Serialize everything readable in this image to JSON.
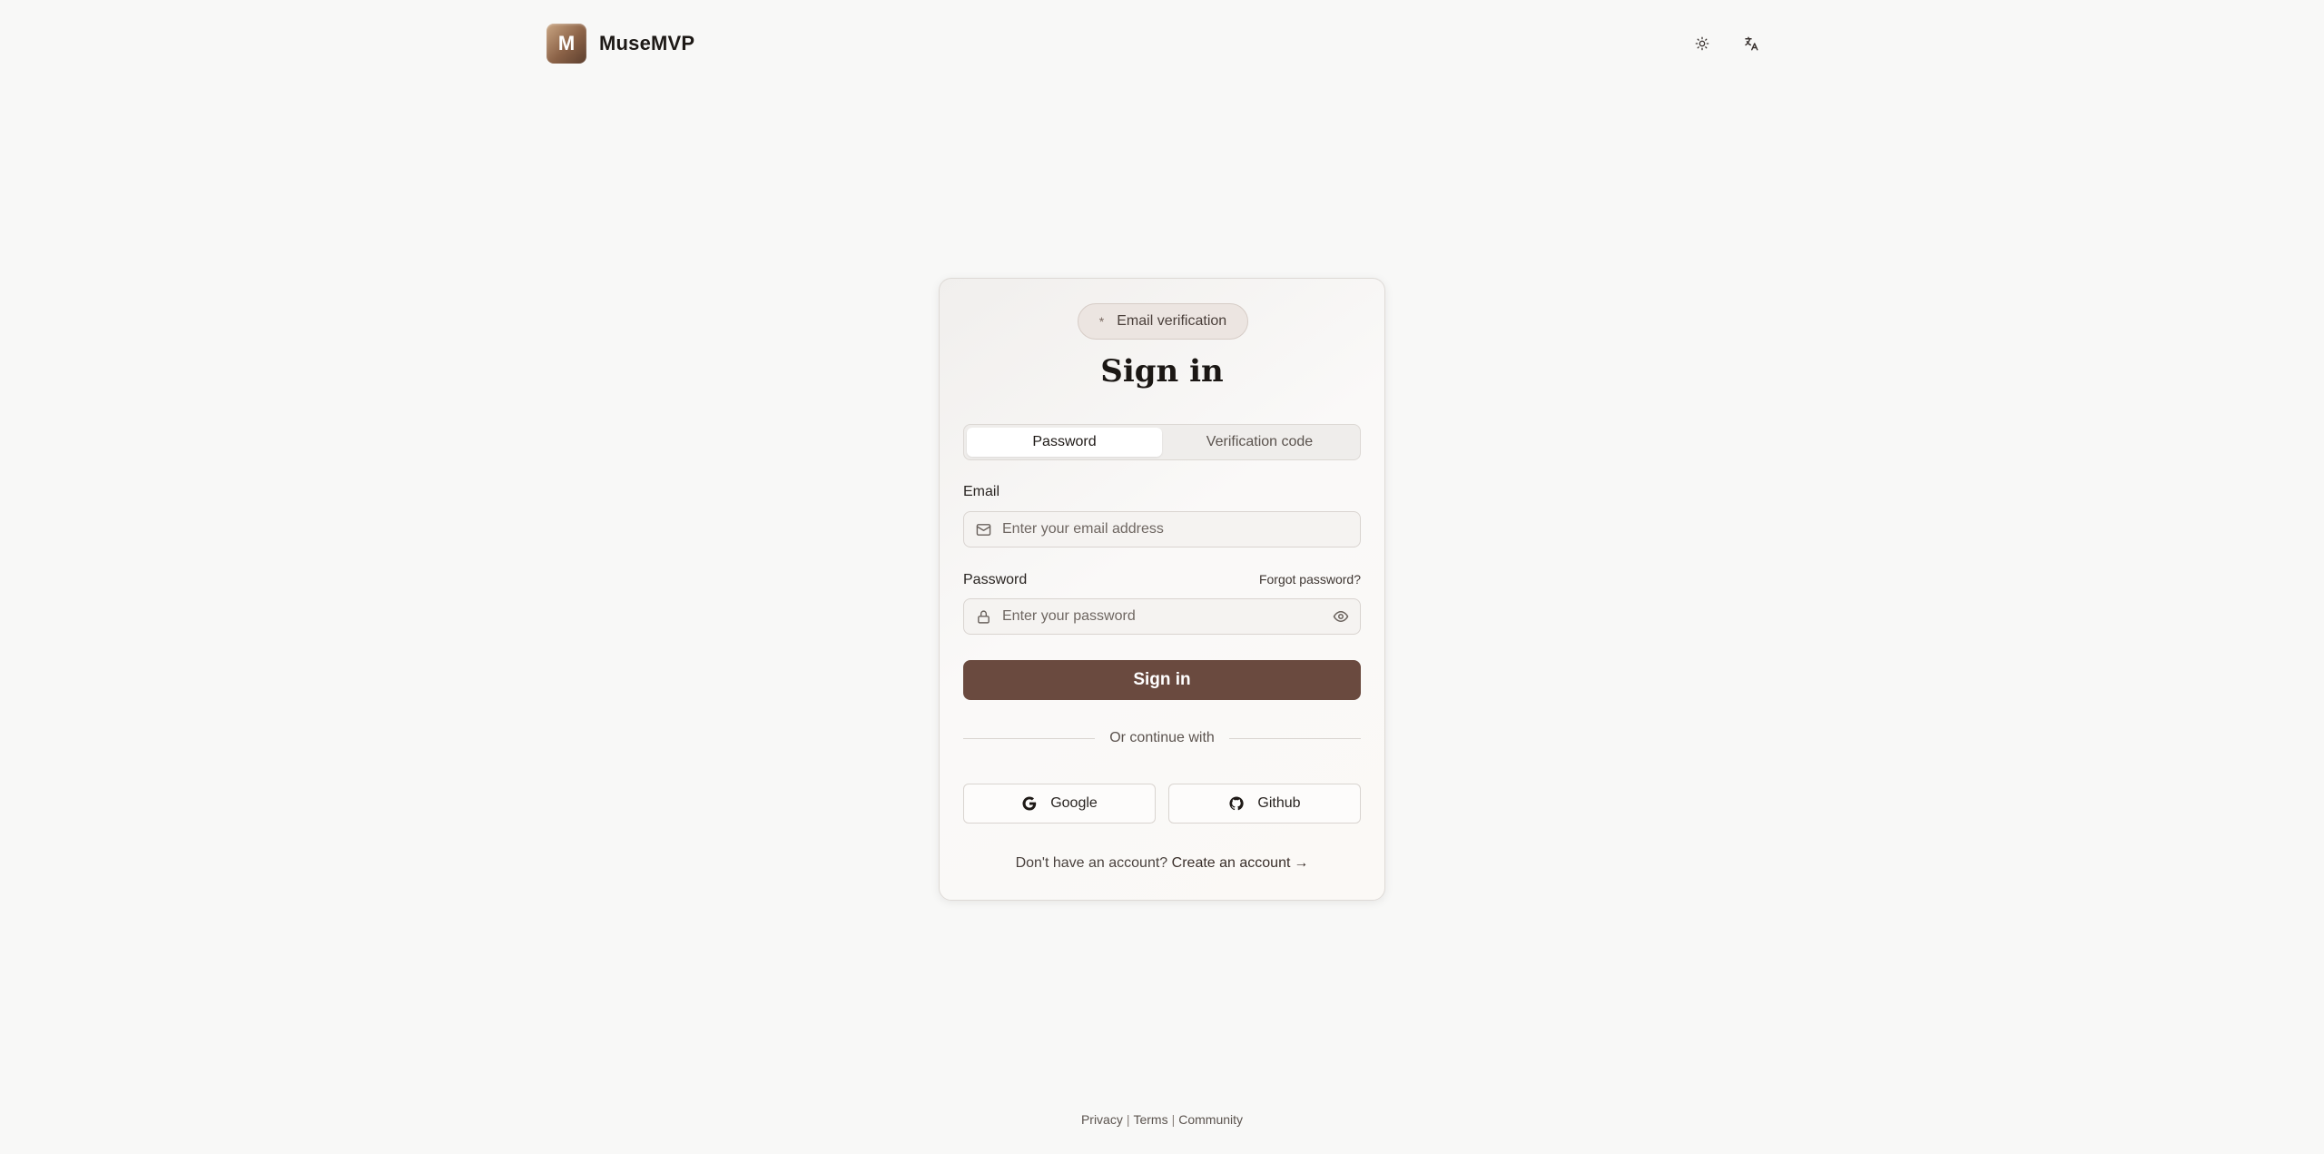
{
  "header": {
    "logo_letter": "M",
    "brand_name": "MuseMVP",
    "theme_icon": "sun-icon",
    "language_icon": "translate-icon"
  },
  "card": {
    "badge": {
      "dot": "*",
      "text": "Email verification"
    },
    "title": "Sign in",
    "tabs": [
      {
        "label": "Password",
        "active": true
      },
      {
        "label": "Verification code",
        "active": false
      }
    ],
    "email": {
      "label": "Email",
      "placeholder": "Enter your email address",
      "value": ""
    },
    "password": {
      "label": "Password",
      "placeholder": "Enter your password",
      "value": "",
      "forgot": "Forgot password?"
    },
    "submit_label": "Sign in",
    "divider_text": "Or continue with",
    "oauth": {
      "google": "Google",
      "github": "Github"
    },
    "signup": {
      "prompt": "Don't have an account?",
      "link": "Create an account",
      "arrow": "→"
    }
  },
  "footer": {
    "links": [
      "Privacy",
      "Terms",
      "Community"
    ],
    "separator": "|"
  },
  "colors": {
    "accent": "#6a4a3f",
    "background": "#f8f8f7"
  }
}
